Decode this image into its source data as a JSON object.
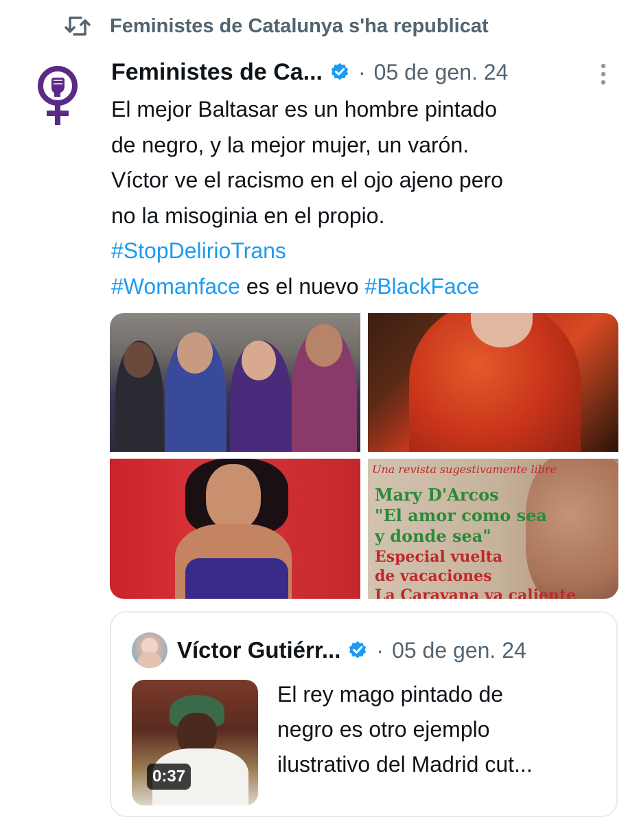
{
  "repost": {
    "icon": "repost-icon",
    "text": "Feministes de Catalunya s'ha republicat"
  },
  "tweet": {
    "avatar_icon": "feminist-fist-symbol",
    "avatar_color": "#5b2a86",
    "author": "Feministes de Ca...",
    "verified_icon": "verified-badge-icon",
    "separator": "·",
    "date": "05 de gen. 24",
    "more_icon": "more-options-icon",
    "text_lines": [
      "El mejor Baltasar es un hombre pintado",
      "de negro, y la mejor mujer, un varón.",
      "Víctor ve el racismo en el ojo ajeno pero",
      "no la misoginia en el propio."
    ],
    "hashtag1": "#StopDelirioTrans",
    "hashtag2": "#Womanface",
    "mid_text": " es el nuevo ",
    "hashtag3": "#BlackFace",
    "media": [
      {
        "description": "group-photo"
      },
      {
        "description": "red-jacket-photo"
      },
      {
        "description": "red-carpet-photo"
      },
      {
        "description": "magazine-cover",
        "text_lines": [
          "Una revista sugestivamente libre",
          "Mary D'Arcos",
          "\"El amor como sea",
          "y donde sea\"",
          "Especial vuelta",
          "de vacaciones",
          "La Caravana va caliente"
        ]
      }
    ]
  },
  "quote": {
    "author": "Víctor Gutiérr...",
    "separator": "·",
    "date": "05 de gen. 24",
    "video_duration": "0:37",
    "text_lines": [
      "El rey mago pintado de",
      "negro es otro ejemplo",
      "ilustrativo del Madrid cut..."
    ]
  },
  "colors": {
    "link": "#1d9bf0",
    "secondary_text": "#536471",
    "verified": "#1d9bf0"
  }
}
